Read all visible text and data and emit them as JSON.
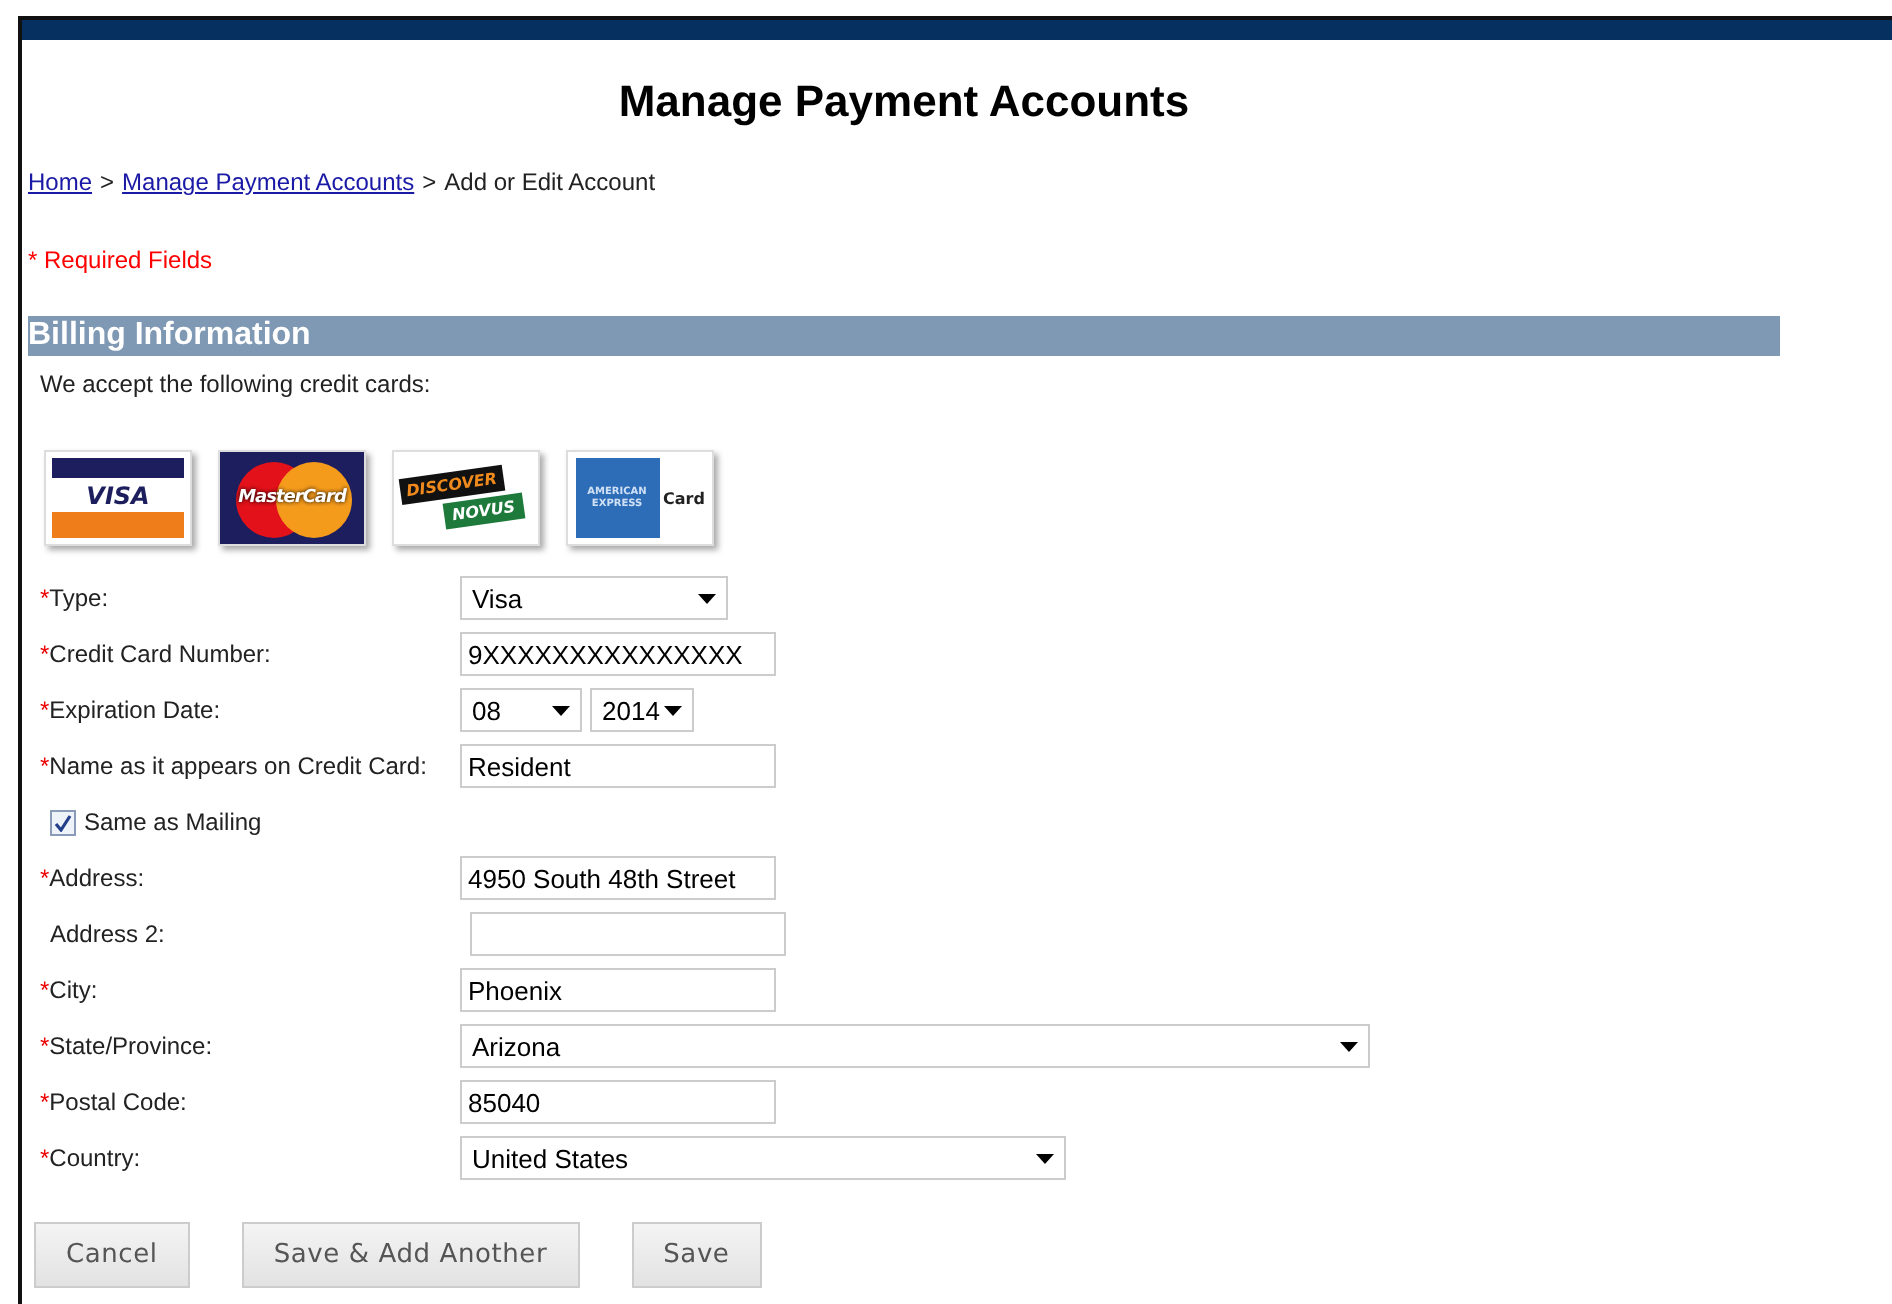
{
  "title": "Manage Payment Accounts",
  "breadcrumb": [
    {
      "kind": "link",
      "label": "Home"
    },
    {
      "kind": "separator",
      "label": ">"
    },
    {
      "kind": "link",
      "label": "Manage Payment Accounts"
    },
    {
      "kind": "separator",
      "label": ">"
    },
    {
      "kind": "current",
      "label": "Add or Edit Account"
    }
  ],
  "required_note": "* Required Fields",
  "section": {
    "title": "Billing Information",
    "intro": "We accept the following credit cards:"
  },
  "cards": [
    {
      "kind": "visa",
      "texts": [
        "VISA"
      ]
    },
    {
      "kind": "mastercard",
      "texts": [
        "MasterCard"
      ]
    },
    {
      "kind": "discover",
      "texts": [
        "DISCOVER",
        "NOVUS"
      ]
    },
    {
      "kind": "amex",
      "texts": [
        "AMERICAN EXPRESS",
        "Card"
      ]
    }
  ],
  "fields": [
    {
      "kind": "select",
      "marker": "*",
      "label": "Type:",
      "value": "Visa"
    },
    {
      "kind": "text",
      "marker": "*",
      "label": "Credit Card Number:",
      "value": "9XXXXXXXXXXXXXXX"
    },
    {
      "kind": "date",
      "marker": "*",
      "label": "Expiration Date:",
      "month": "08",
      "year": "2014"
    },
    {
      "kind": "text",
      "marker": "*",
      "label": "Name as it appears on Credit Card:",
      "value": "Resident"
    },
    {
      "kind": "checkbox",
      "label": "Same as Mailing",
      "checked": true
    },
    {
      "kind": "text",
      "marker": "*",
      "label": "Address:",
      "value": "4950 South 48th Street"
    },
    {
      "kind": "text",
      "label": "Address 2:"
    },
    {
      "kind": "text",
      "marker": "*",
      "label": "City:",
      "value": "Phoenix"
    },
    {
      "kind": "select",
      "marker": "*",
      "label": "State/Province:",
      "value": "Arizona"
    },
    {
      "kind": "text",
      "marker": "*",
      "label": "Postal Code:",
      "value": "85040"
    },
    {
      "kind": "select",
      "marker": "*",
      "label": "Country:",
      "value": "United States"
    }
  ],
  "buttons": [
    "Cancel",
    "Save & Add Another",
    "Save"
  ]
}
